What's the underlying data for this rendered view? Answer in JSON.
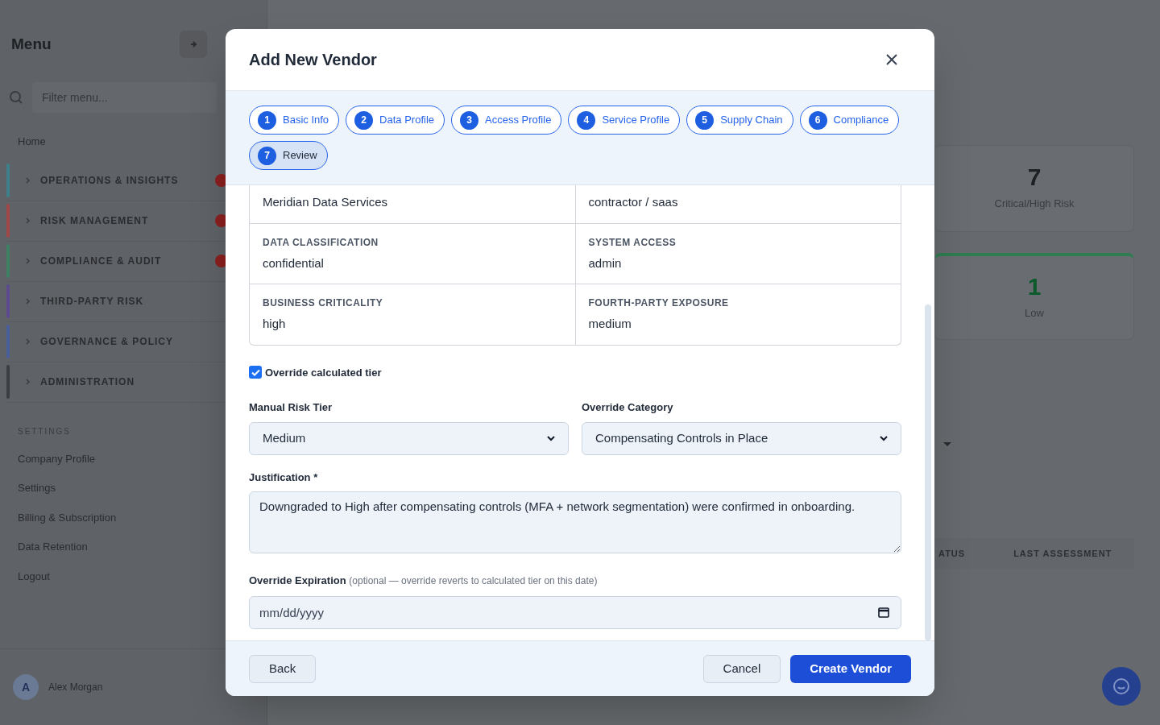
{
  "sidebar": {
    "title": "Menu",
    "filter_placeholder": "Filter menu...",
    "home": "Home",
    "groups": [
      {
        "label": "OPERATIONS & INSIGHTS",
        "color": "#3f7f8a",
        "alert": true
      },
      {
        "label": "RISK MANAGEMENT",
        "color": "#a04848",
        "alert": true
      },
      {
        "label": "COMPLIANCE & AUDIT",
        "color": "#3f7f62",
        "alert": true
      },
      {
        "label": "THIRD-PARTY RISK",
        "color": "#5d4a8f",
        "alert": false
      },
      {
        "label": "GOVERNANCE & POLICY",
        "color": "#4a5f9a",
        "alert": false
      },
      {
        "label": "ADMINISTRATION",
        "color": "#3c3e42",
        "alert": false
      }
    ],
    "settings_heading": "SETTINGS",
    "settings_items": [
      "Company Profile",
      "Settings",
      "Billing & Subscription",
      "Data Retention",
      "Logout"
    ],
    "user": {
      "initial": "A",
      "name": "Alex Morgan"
    }
  },
  "stats": [
    {
      "value": "7",
      "label": "Critical/High Risk",
      "color": "#1e2023"
    },
    {
      "value": "1",
      "label": "Low",
      "color": "#0c5a2c"
    }
  ],
  "table_headers": [
    "ATUS",
    "LAST ASSESSMENT"
  ],
  "modal": {
    "title": "Add New Vendor",
    "steps": [
      {
        "number": "1",
        "label": "Basic Info",
        "selected": false
      },
      {
        "number": "2",
        "label": "Data Profile",
        "selected": false
      },
      {
        "number": "3",
        "label": "Access Profile",
        "selected": false
      },
      {
        "number": "4",
        "label": "Service Profile",
        "selected": false
      },
      {
        "number": "5",
        "label": "Supply Chain",
        "selected": false
      },
      {
        "number": "6",
        "label": "Compliance",
        "selected": false
      },
      {
        "number": "7",
        "label": "Review",
        "selected": true
      }
    ],
    "review_rows": [
      [
        {
          "value": "Meridian Data Services"
        },
        {
          "value": "contractor / saas"
        }
      ],
      [
        {
          "label": "DATA CLASSIFICATION",
          "value": "confidential"
        },
        {
          "label": "SYSTEM ACCESS",
          "value": "admin"
        }
      ],
      [
        {
          "label": "BUSINESS CRITICALITY",
          "value": "high"
        },
        {
          "label": "FOURTH-PARTY EXPOSURE",
          "value": "medium"
        }
      ]
    ],
    "override": {
      "label": "Override calculated tier",
      "checked": true
    },
    "manual_tier": {
      "label": "Manual Risk Tier",
      "value": "Medium"
    },
    "override_category": {
      "label": "Override Category",
      "value": "Compensating Controls in Place"
    },
    "justification": {
      "label": "Justification *",
      "value": "Downgraded to High after compensating controls (MFA + network segmentation) were confirmed in onboarding."
    },
    "expiration": {
      "label": "Override Expiration",
      "hint": "(optional — override reverts to calculated tier on this date)",
      "placeholder": "mm/dd/yyyy"
    },
    "buttons": {
      "back": "Back",
      "cancel": "Cancel",
      "create": "Create Vendor"
    }
  }
}
